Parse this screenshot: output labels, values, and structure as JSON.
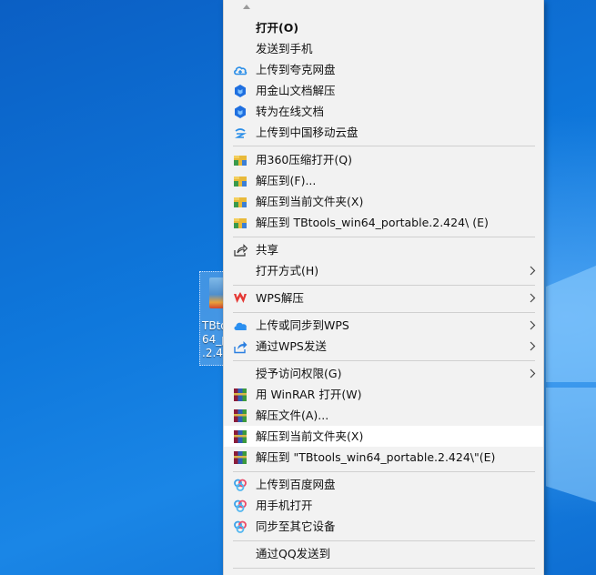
{
  "desktop_icon": {
    "name": "TBtoo\n64_p\n.2.4"
  },
  "menu": {
    "items": [
      {
        "label": "打开(O)",
        "icon": "",
        "bold": true
      },
      {
        "label": "发送到手机",
        "icon": ""
      },
      {
        "label": "上传到夸克网盘",
        "icon": "cloud-upload-icon"
      },
      {
        "label": "用金山文档解压",
        "icon": "kingsoft-docs-icon"
      },
      {
        "label": "转为在线文档",
        "icon": "kingsoft-docs-icon"
      },
      {
        "label": "上传到中国移动云盘",
        "icon": "china-mobile-cloud-icon"
      },
      {
        "label": "用360压缩打开(Q)",
        "icon": "360-zip-icon"
      },
      {
        "label": "解压到(F)...",
        "icon": "360-zip-icon"
      },
      {
        "label": "解压到当前文件夹(X)",
        "icon": "360-zip-icon"
      },
      {
        "label": "解压到 TBtools_win64_portable.2.424\\ (E)",
        "icon": "360-zip-icon"
      },
      {
        "label": "共享",
        "icon": "share-icon"
      },
      {
        "label": "打开方式(H)",
        "icon": ""
      },
      {
        "label": "WPS解压",
        "icon": "wps-icon"
      },
      {
        "label": "上传或同步到WPS",
        "icon": "wps-cloud-icon"
      },
      {
        "label": "通过WPS发送",
        "icon": "wps-send-icon"
      },
      {
        "label": "授予访问权限(G)",
        "icon": ""
      },
      {
        "label": "用 WinRAR 打开(W)",
        "icon": "winrar-icon"
      },
      {
        "label": "解压文件(A)...",
        "icon": "winrar-icon"
      },
      {
        "label": "解压到当前文件夹(X)",
        "icon": "winrar-icon"
      },
      {
        "label": "解压到 \"TBtools_win64_portable.2.424\\\"(E)",
        "icon": "winrar-icon"
      },
      {
        "label": "上传到百度网盘",
        "icon": "baidu-netdisk-icon"
      },
      {
        "label": "用手机打开",
        "icon": "baidu-netdisk-icon"
      },
      {
        "label": "同步至其它设备",
        "icon": "baidu-netdisk-icon"
      },
      {
        "label": "通过QQ发送到",
        "icon": ""
      }
    ]
  }
}
